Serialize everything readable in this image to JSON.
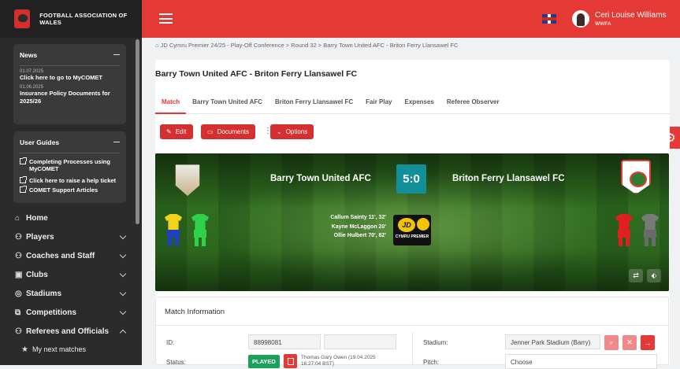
{
  "sidebar": {
    "org_title": "FOOTBALL ASSOCIATION OF WALES",
    "news": {
      "title": "News",
      "items": [
        {
          "date": "01.07.2025",
          "text": "Click here to go to MyCOMET"
        },
        {
          "date": "01.06.2025",
          "text": "Insurance Policy Documents for 2025/26"
        }
      ]
    },
    "user_guides": {
      "title": "User Guides",
      "items": [
        "Completing Processes using MyCOMET",
        "Click here to raise a help ticket",
        "COMET Support Articles"
      ]
    },
    "nav": [
      {
        "label": "Home",
        "icon": "home-icon"
      },
      {
        "label": "Players",
        "icon": "players-icon"
      },
      {
        "label": "Coaches and Staff",
        "icon": "coaches-icon"
      },
      {
        "label": "Clubs",
        "icon": "clubs-icon"
      },
      {
        "label": "Stadiums",
        "icon": "stadium-icon"
      },
      {
        "label": "Competitions",
        "icon": "competitions-icon"
      },
      {
        "label": "Referees and Officials",
        "icon": "referees-icon"
      },
      {
        "label": "My next matches",
        "icon": "star-icon"
      }
    ]
  },
  "topbar": {
    "user_name": "Ceri Louise Williams",
    "user_role": "WWFA",
    "accent": "#e53935"
  },
  "breadcrumb": "JD Cymru Premier 24/25 - Play-Off Conference > Round 32 > Barry Town United AFC - Briton Ferry Llansawel FC",
  "match": {
    "title": "Barry Town United AFC - Briton Ferry Llansawel FC",
    "tabs": [
      "Match",
      "Barry Town United AFC",
      "Briton Ferry Llansawel FC",
      "Fair Play",
      "Expenses",
      "Referee Observer"
    ],
    "buttons": {
      "edit": "Edit",
      "documents": "Documents",
      "options": "Options"
    },
    "home_team": "Barry Town United AFC",
    "away_team": "Briton Ferry Llansawel FC",
    "score": "5:0",
    "scorers": [
      "Callum Sainty 11', 32'",
      "Kayne McLaggon 20'",
      "Ollie Hulbert 70', 82'"
    ],
    "league_logo_text": "CYMRU PREMIER",
    "league_logo_mark": "JD"
  },
  "info": {
    "title": "Match Information",
    "id_label": "ID:",
    "id_value": "88998081",
    "status_label": "Status:",
    "status_value": "PLAYED",
    "status_by": "Thomas Gary Owen (19.04.2025 16:27:04 BST)",
    "stadium_label": "Stadium:",
    "stadium_value": "Jenner Park Stadium (Barry)",
    "pitch_label": "Pitch:",
    "pitch_value": "Choose"
  }
}
